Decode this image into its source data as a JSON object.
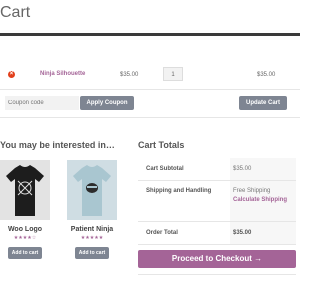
{
  "page": {
    "title": "Cart"
  },
  "cart": {
    "items": [
      {
        "name": "Ninja Silhouette",
        "price": "$35.00",
        "quantity": "1",
        "subtotal": "$35.00"
      }
    ],
    "remove_symbol": "×",
    "coupon_placeholder": "Coupon code",
    "apply_coupon_label": "Apply Coupon",
    "update_cart_label": "Update Cart"
  },
  "related": {
    "title": "You may be interested in…",
    "products": [
      {
        "name": "Woo Logo",
        "rating_stars": "★★★★☆",
        "add_label": "Add to cart"
      },
      {
        "name": "Patient Ninja",
        "rating_stars": "★★★★★",
        "add_label": "Add to cart"
      }
    ]
  },
  "totals": {
    "title": "Cart Totals",
    "subtotal_label": "Cart Subtotal",
    "subtotal_value": "$35.00",
    "shipping_label": "Shipping and Handling",
    "shipping_value": "Free Shipping",
    "calculate_shipping_label": "Calculate Shipping",
    "order_total_label": "Order Total",
    "order_total_value": "$35.00"
  },
  "checkout": {
    "label": "Proceed to Checkout →"
  },
  "colors": {
    "accent": "#a46497",
    "button_grey": "#7e8592",
    "remove_red": "#e2401c"
  }
}
